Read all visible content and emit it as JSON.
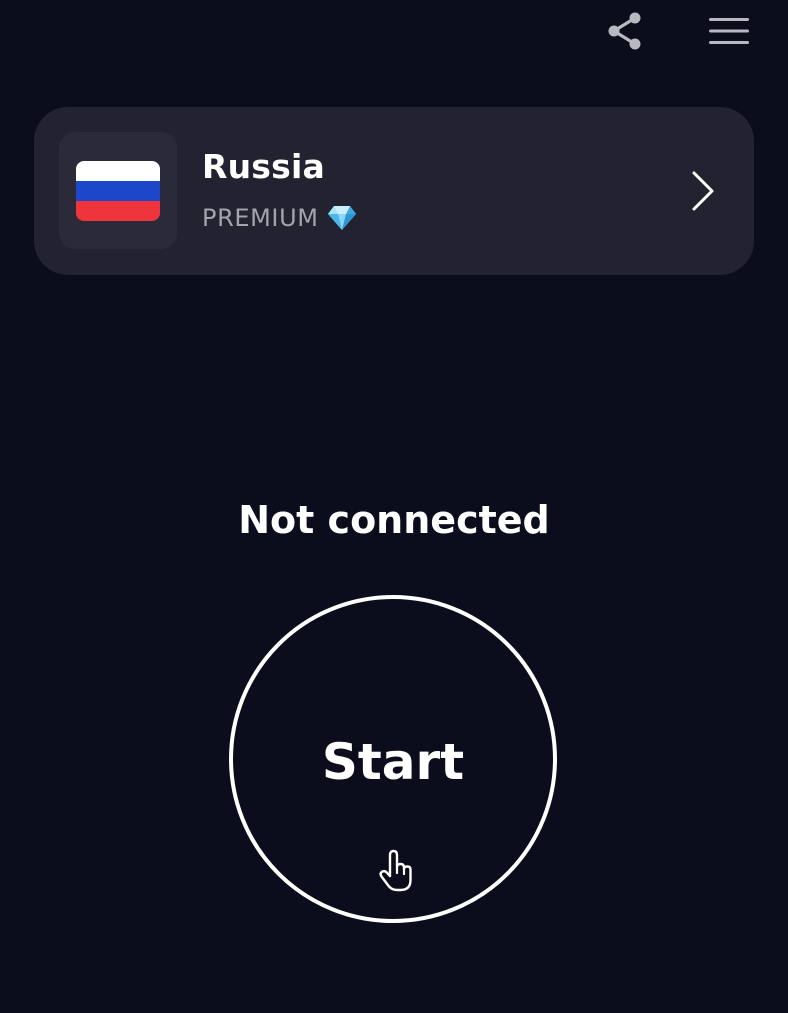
{
  "topbar": {
    "share_icon": "share-icon",
    "menu_icon": "hamburger-menu-icon"
  },
  "server": {
    "country": "Russia",
    "tier": "PREMIUM",
    "tier_icon": "diamond-icon",
    "flag_icon": "russia-flag-icon",
    "flag_colors": [
      "#ffffff",
      "#1c47c9",
      "#f0343b"
    ],
    "chevron_icon": "chevron-right-icon"
  },
  "status": {
    "text": "Not connected"
  },
  "connect": {
    "label": "Start",
    "icon": "tap-hand-icon"
  },
  "colors": {
    "background": "#0c0d1c",
    "card": "#222231",
    "flag_box": "#2a2a39",
    "muted_text": "#a3a3ad"
  }
}
